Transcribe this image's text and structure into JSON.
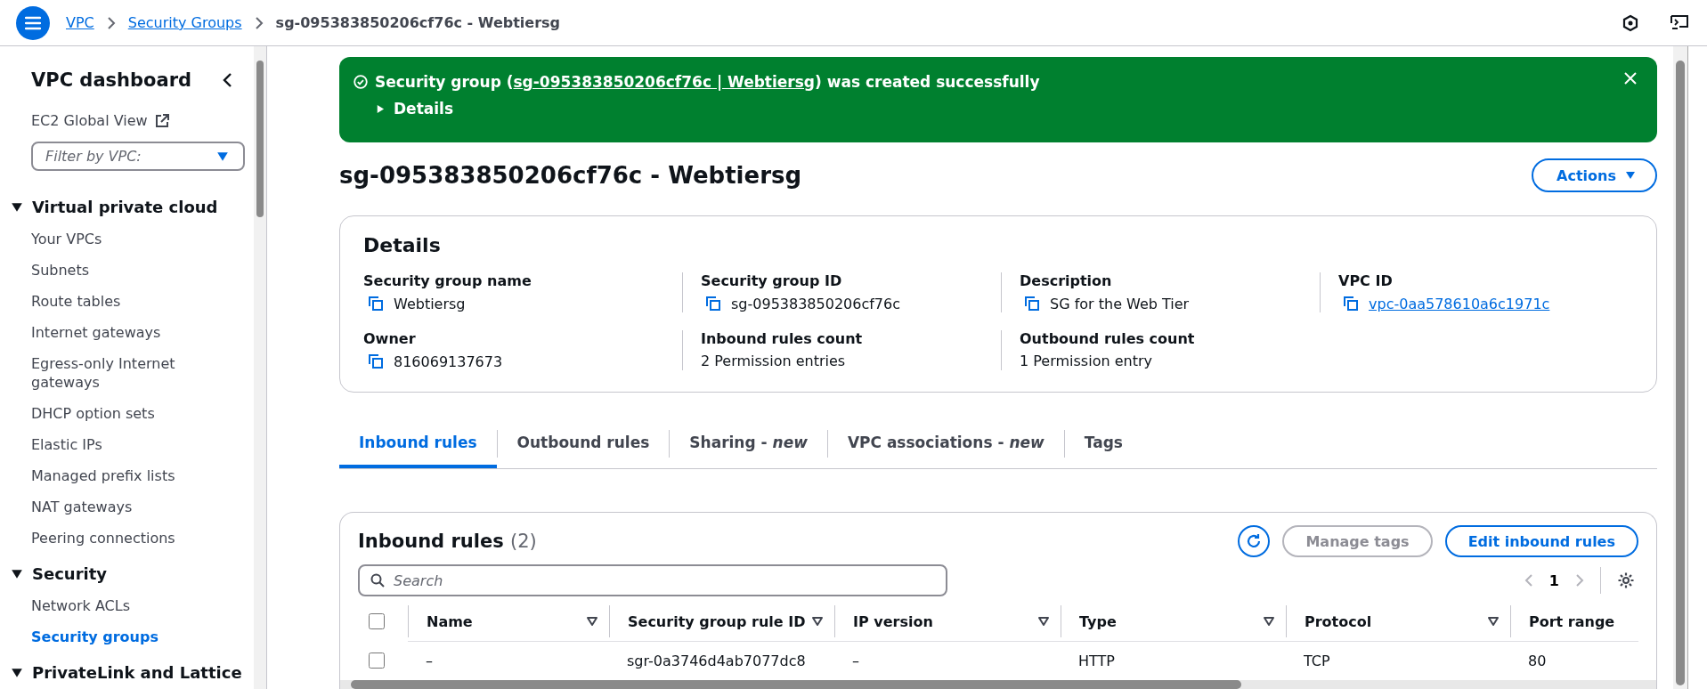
{
  "top_bar": {
    "breadcrumbs": [
      {
        "label": "VPC",
        "link": true
      },
      {
        "label": "Security Groups",
        "link": true
      },
      {
        "label": "sg-095383850206cf76c - Webtiersg",
        "link": false
      }
    ]
  },
  "sidebar": {
    "title": "VPC dashboard",
    "global_view": "EC2 Global View",
    "filter": {
      "placeholder": "Filter by VPC:"
    },
    "sections": [
      {
        "title": "Virtual private cloud",
        "expanded": true,
        "items": [
          {
            "label": "Your VPCs",
            "selected": false
          },
          {
            "label": "Subnets",
            "selected": false
          },
          {
            "label": "Route tables",
            "selected": false
          },
          {
            "label": "Internet gateways",
            "selected": false
          },
          {
            "label": "Egress-only Internet gateways",
            "selected": false
          },
          {
            "label": "DHCP option sets",
            "selected": false
          },
          {
            "label": "Elastic IPs",
            "selected": false
          },
          {
            "label": "Managed prefix lists",
            "selected": false
          },
          {
            "label": "NAT gateways",
            "selected": false
          },
          {
            "label": "Peering connections",
            "selected": false
          }
        ]
      },
      {
        "title": "Security",
        "expanded": true,
        "items": [
          {
            "label": "Network ACLs",
            "selected": false
          },
          {
            "label": "Security groups",
            "selected": true
          }
        ]
      },
      {
        "title": "PrivateLink and Lattice",
        "expanded": true
      }
    ]
  },
  "banner": {
    "before": "Security group (",
    "link": "sg-095383850206cf76c | Webtiersg",
    "after": ") was created successfully",
    "details": "Details"
  },
  "page_title": "sg-095383850206cf76c - Webtiersg",
  "actions_button": "Actions",
  "details": {
    "title": "Details",
    "fields": [
      {
        "label": "Security group name",
        "value": "Webtiersg",
        "copyable": true,
        "link": false
      },
      {
        "label": "Security group ID",
        "value": "sg-095383850206cf76c",
        "copyable": true,
        "link": false
      },
      {
        "label": "Description",
        "value": "SG for the Web Tier",
        "copyable": true,
        "link": false
      },
      {
        "label": "VPC ID",
        "value": "vpc-0aa578610a6c1971c",
        "copyable": true,
        "link": true
      },
      {
        "label": "Owner",
        "value": "816069137673",
        "copyable": true,
        "link": false
      },
      {
        "label": "Inbound rules count",
        "value": "2 Permission entries",
        "copyable": false,
        "link": false
      },
      {
        "label": "Outbound rules count",
        "value": "1 Permission entry",
        "copyable": false,
        "link": false
      }
    ]
  },
  "tabs": [
    {
      "label": "Inbound rules",
      "selected": true
    },
    {
      "label": "Outbound rules",
      "selected": false
    },
    {
      "label": "Sharing - *new*",
      "selected": false
    },
    {
      "label": "VPC associations - *new*",
      "selected": false
    },
    {
      "label": "Tags",
      "selected": false
    }
  ],
  "table": {
    "title": "Inbound rules",
    "count": "(2)",
    "manage_tags": {
      "label": "Manage tags",
      "disabled": true
    },
    "edit_button": "Edit inbound rules",
    "search": {
      "placeholder": "Search"
    },
    "page": "1",
    "all_selected": false,
    "columns": [
      {
        "label": "Name",
        "sortable": true
      },
      {
        "label": "Security group rule ID",
        "sortable": true
      },
      {
        "label": "IP version",
        "sortable": true
      },
      {
        "label": "Type",
        "sortable": true
      },
      {
        "label": "Protocol",
        "sortable": true
      },
      {
        "label": "Port range",
        "sortable": false
      }
    ],
    "rows": [
      {
        "selected": false,
        "cells": [
          "–",
          "sgr-0a3746d4ab7077dc8",
          "–",
          "HTTP",
          "TCP",
          "80"
        ]
      }
    ]
  }
}
